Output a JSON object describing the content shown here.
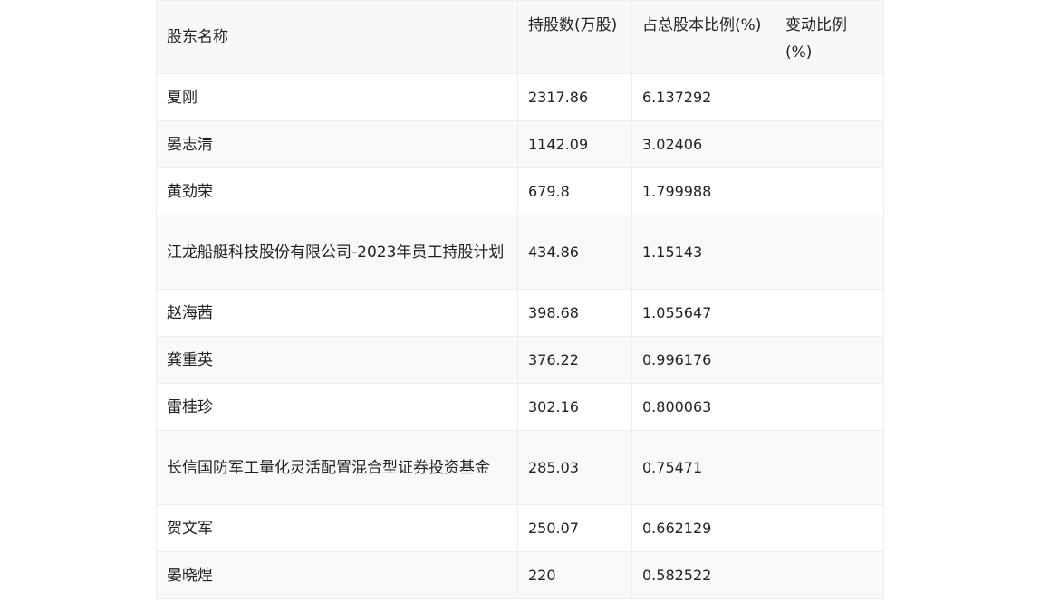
{
  "table": {
    "headers": [
      "股东名称",
      "持股数(万股)",
      "占总股本比例(%)",
      "变动比例(%)"
    ],
    "rows": [
      {
        "name": "夏刚",
        "shares": "2317.86",
        "ratio": "6.137292",
        "change": ""
      },
      {
        "name": "晏志清",
        "shares": "1142.09",
        "ratio": "3.02406",
        "change": ""
      },
      {
        "name": "黄劲荣",
        "shares": "679.8",
        "ratio": "1.799988",
        "change": ""
      },
      {
        "name": "江龙船艇科技股份有限公司-2023年员工持股计划",
        "shares": "434.86",
        "ratio": "1.15143",
        "change": ""
      },
      {
        "name": "赵海茜",
        "shares": "398.68",
        "ratio": "1.055647",
        "change": ""
      },
      {
        "name": "龚重英",
        "shares": "376.22",
        "ratio": "0.996176",
        "change": ""
      },
      {
        "name": "雷桂珍",
        "shares": "302.16",
        "ratio": "0.800063",
        "change": ""
      },
      {
        "name": "长信国防军工量化灵活配置混合型证券投资基金",
        "shares": "285.03",
        "ratio": "0.75471",
        "change": ""
      },
      {
        "name": "贺文军",
        "shares": "250.07",
        "ratio": "0.662129",
        "change": ""
      },
      {
        "name": "晏晓煌",
        "shares": "220",
        "ratio": "0.582522",
        "change": ""
      }
    ]
  }
}
